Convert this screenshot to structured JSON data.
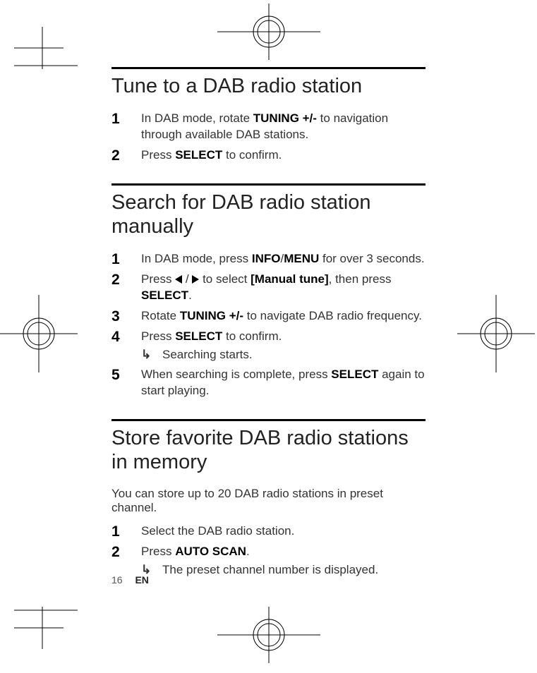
{
  "sections": [
    {
      "heading": "Tune to a DAB radio station",
      "intro": "",
      "steps": [
        {
          "html": "In DAB mode, rotate <strong>TUNING +/-</strong> to navigation through available DAB stations."
        },
        {
          "html": "Press <strong>SELECT</strong> to confirm."
        }
      ]
    },
    {
      "heading": "Search for DAB radio station manually",
      "intro": "",
      "steps": [
        {
          "html": "In DAB mode, press <strong>INFO</strong>/<strong>MENU</strong> for over 3 seconds."
        },
        {
          "html": "Press <span class=\"tri-left\" data-name=\"prev-icon\" data-interactable=\"false\"></span> / <span class=\"tri-right\" data-name=\"next-icon\" data-interactable=\"false\"></span> to select <strong>[Manual tune]</strong>, then press <strong>SELECT</strong>."
        },
        {
          "html": "Rotate <strong>TUNING +/-</strong> to navigate DAB radio frequency."
        },
        {
          "html": "Press <strong>SELECT</strong> to confirm.",
          "sub": "Searching starts."
        },
        {
          "html": "When searching is complete, press <strong>SELECT</strong> again to start playing."
        }
      ]
    },
    {
      "heading": "Store favorite DAB radio stations in memory",
      "intro": "You can store up to 20 DAB radio stations in preset channel.",
      "steps": [
        {
          "html": "Select the DAB radio station."
        },
        {
          "html": "Press <strong>AUTO SCAN</strong>.",
          "sub": "The preset channel number is displayed."
        }
      ]
    }
  ],
  "footer": {
    "page": "16",
    "lang": "EN"
  }
}
